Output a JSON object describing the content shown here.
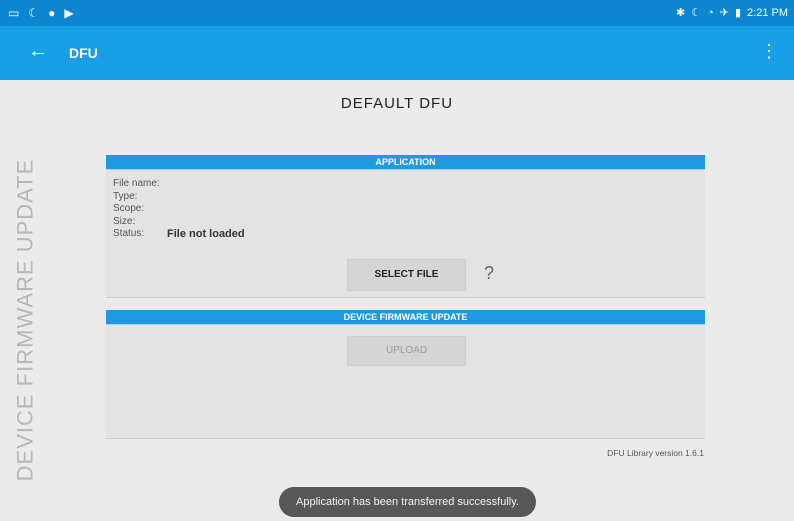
{
  "status_bar": {
    "time": "2:21 PM",
    "left_icons": [
      "notification-icon",
      "moon-icon",
      "location-icon",
      "play-store-icon"
    ],
    "right_icons": [
      "bluetooth-icon",
      "moon-icon",
      "wifi-icon",
      "airplane-icon",
      "battery-icon"
    ]
  },
  "app_bar": {
    "title": "DFU"
  },
  "page": {
    "title": "DEFAULT DFU",
    "vertical_title": "DEVICE FIRMWARE UPDATE"
  },
  "application": {
    "header": "APPLICATION",
    "file_name_label": "File name:",
    "type_label": "Type:",
    "scope_label": "Scope:",
    "size_label": "Size:",
    "status_label": "Status:",
    "status_value": "File not loaded",
    "select_file": "SELECT FILE",
    "help": "?"
  },
  "dfu": {
    "header": "DEVICE FIRMWARE UPDATE",
    "upload": "UPLOAD"
  },
  "footer": {
    "version": "DFU Library version 1.6.1"
  },
  "toast": {
    "message": "Application has been transferred successfully."
  },
  "colors": {
    "status_bar": "#0b86cf",
    "app_bar": "#199fe6",
    "panel_header": "#1e9be0"
  }
}
